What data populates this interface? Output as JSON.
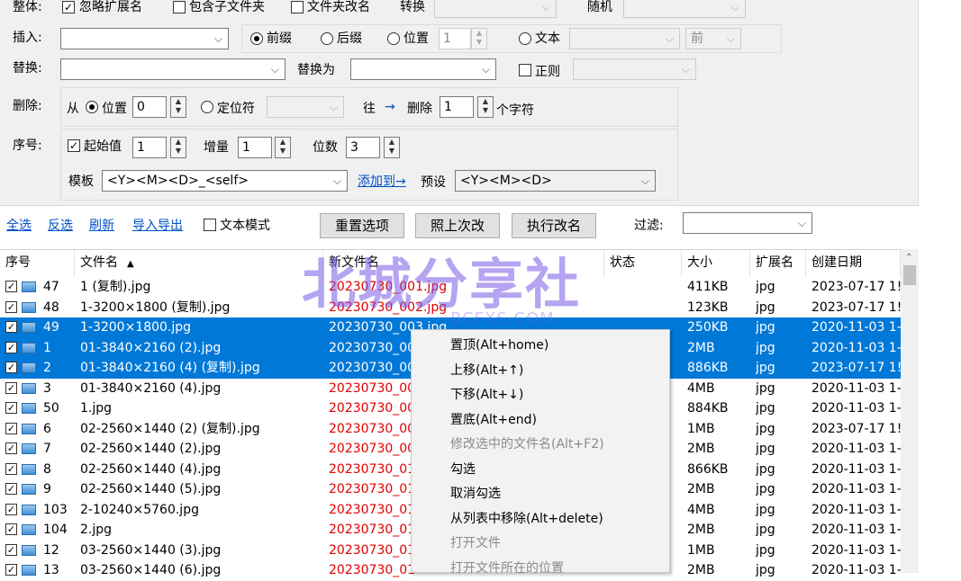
{
  "options": {
    "row1": {
      "label": "整体:",
      "ignore_ext": "忽略扩展名",
      "ignore_ext_checked": true,
      "include_sub": "包含子文件夹",
      "rename_folder": "文件夹改名",
      "convert": "转换",
      "convert_value": "",
      "random": "随机",
      "random_value": ""
    },
    "insert": {
      "label": "插入:",
      "value": "",
      "prefix": "前缀",
      "suffix": "后缀",
      "position": "位置",
      "position_value": "1",
      "text": "文本",
      "text_value": "",
      "dir_value": "前",
      "selected": "前缀"
    },
    "replace": {
      "label": "替换:",
      "value": "",
      "replace_with": "替换为",
      "replace_value": "",
      "regex": "正则",
      "regex_value": ""
    },
    "delete": {
      "label": "删除:",
      "from": "从",
      "position": "位置",
      "position_value": "0",
      "locator": "定位符",
      "locator_value": "",
      "toward": "往",
      "arrow": "→",
      "delete": "删除",
      "count": "1",
      "unit": "个字符"
    },
    "seq": {
      "label": "序号:",
      "start": "起始值",
      "start_checked": true,
      "start_value": "1",
      "step": "增量",
      "step_value": "1",
      "digits": "位数",
      "digits_value": "3"
    },
    "template": {
      "label": "模板",
      "value": "<Y><M><D>_<self>",
      "add_to": "添加到→",
      "preset": "预设",
      "preset_value": "<Y><M><D>"
    }
  },
  "toolbar": {
    "select_all": "全选",
    "invert": "反选",
    "refresh": "刷新",
    "import_export": "导入导出",
    "text_mode": "文本模式",
    "reset": "重置选项",
    "last": "照上次改",
    "execute": "执行改名",
    "filter": "过滤:",
    "filter_value": ""
  },
  "columns": [
    "序号",
    "文件名",
    "新文件名",
    "状态",
    "大小",
    "扩展名",
    "创建日期"
  ],
  "sort_indicator": "▲",
  "rows": [
    {
      "no": "47",
      "name": "1 (复制).jpg",
      "new": "20230730_001.jpg",
      "size": "411KB",
      "ext": "jpg",
      "date": "2023-07-17 1!",
      "sel": false,
      "red": true
    },
    {
      "no": "48",
      "name": "1-3200×1800 (复制).jpg",
      "new": "20230730_002.jpg",
      "size": "123KB",
      "ext": "jpg",
      "date": "2023-07-17 1!",
      "sel": false,
      "red": true
    },
    {
      "no": "49",
      "name": "1-3200×1800.jpg",
      "new": "20230730_003.jpg",
      "size": "250KB",
      "ext": "jpg",
      "date": "2020-11-03 1-",
      "sel": true,
      "red": false
    },
    {
      "no": "1",
      "name": "01-3840×2160 (2).jpg",
      "new": "20230730_00",
      "size": "2MB",
      "ext": "jpg",
      "date": "2020-11-03 1-",
      "sel": true,
      "red": false
    },
    {
      "no": "2",
      "name": "01-3840×2160 (4) (复制).jpg",
      "new": "20230730_00",
      "size": "886KB",
      "ext": "jpg",
      "date": "2023-07-17 1!",
      "sel": true,
      "red": false
    },
    {
      "no": "3",
      "name": "01-3840×2160 (4).jpg",
      "new": "20230730_00",
      "size": "4MB",
      "ext": "jpg",
      "date": "2020-11-03 1-",
      "sel": false,
      "red": true
    },
    {
      "no": "50",
      "name": "1.jpg",
      "new": "20230730_00",
      "size": "884KB",
      "ext": "jpg",
      "date": "2020-11-03 1-",
      "sel": false,
      "red": true
    },
    {
      "no": "6",
      "name": "02-2560×1440 (2) (复制).jpg",
      "new": "20230730_00",
      "size": "1MB",
      "ext": "jpg",
      "date": "2023-07-17 1!",
      "sel": false,
      "red": true
    },
    {
      "no": "7",
      "name": "02-2560×1440 (2).jpg",
      "new": "20230730_00",
      "size": "2MB",
      "ext": "jpg",
      "date": "2020-11-03 1-",
      "sel": false,
      "red": true
    },
    {
      "no": "8",
      "name": "02-2560×1440 (4).jpg",
      "new": "20230730_01",
      "size": "866KB",
      "ext": "jpg",
      "date": "2020-11-03 1-",
      "sel": false,
      "red": true
    },
    {
      "no": "9",
      "name": "02-2560×1440 (5).jpg",
      "new": "20230730_01",
      "size": "2MB",
      "ext": "jpg",
      "date": "2020-11-03 1-",
      "sel": false,
      "red": true
    },
    {
      "no": "103",
      "name": "2-10240×5760.jpg",
      "new": "20230730_01",
      "size": "4MB",
      "ext": "jpg",
      "date": "2020-11-03 1-",
      "sel": false,
      "red": true
    },
    {
      "no": "104",
      "name": "2.jpg",
      "new": "20230730_01",
      "size": "2MB",
      "ext": "jpg",
      "date": "2020-11-03 1-",
      "sel": false,
      "red": true
    },
    {
      "no": "12",
      "name": "03-2560×1440 (3).jpg",
      "new": "20230730_01",
      "size": "1MB",
      "ext": "jpg",
      "date": "2020-11-03 1-",
      "sel": false,
      "red": true
    },
    {
      "no": "13",
      "name": "03-2560×1440 (6).jpg",
      "new": "20230730_01",
      "size": "2MB",
      "ext": "jpg",
      "date": "2020-11-03 1-",
      "sel": false,
      "red": true
    }
  ],
  "context_menu": [
    {
      "label": "置顶(Alt+home)",
      "disabled": false
    },
    {
      "label": "上移(Alt+↑)",
      "disabled": false
    },
    {
      "label": "下移(Alt+↓)",
      "disabled": false
    },
    {
      "label": "置底(Alt+end)",
      "disabled": false
    },
    {
      "label": "修改选中的文件名(Alt+F2)",
      "disabled": true
    },
    {
      "label": "勾选",
      "disabled": false
    },
    {
      "label": "取消勾选",
      "disabled": false
    },
    {
      "label": "从列表中移除(Alt+delete)",
      "disabled": false
    },
    {
      "label": "打开文件",
      "disabled": true
    },
    {
      "label": "打开文件所在的位置",
      "disabled": true
    }
  ],
  "watermark": {
    "main": "北城分享社",
    "sub": "BCFXS.COM"
  },
  "colors": {
    "selection": "#0078d7",
    "new_name": "#e00000",
    "link": "#0050c8"
  }
}
